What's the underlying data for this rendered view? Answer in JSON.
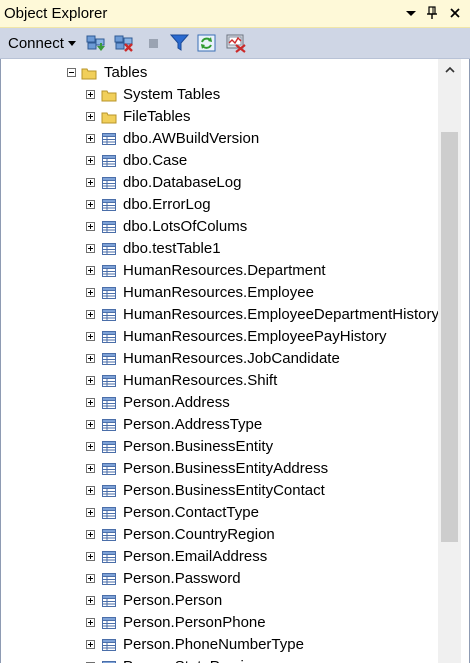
{
  "window": {
    "title": "Object Explorer",
    "controls": [
      "dropdown-icon",
      "pin-icon",
      "close-icon"
    ]
  },
  "toolbar": {
    "connect_label": "Connect",
    "buttons": [
      "connect-object-explorer-icon",
      "disconnect-icon",
      "stop-icon",
      "filter-icon",
      "refresh-icon",
      "activity-monitor-icon"
    ]
  },
  "tree": {
    "root": {
      "label": "Tables",
      "expanded": true
    },
    "children": [
      {
        "label": "System Tables",
        "type": "folder"
      },
      {
        "label": "FileTables",
        "type": "folder"
      },
      {
        "label": "dbo.AWBuildVersion",
        "type": "table"
      },
      {
        "label": "dbo.Case",
        "type": "table"
      },
      {
        "label": "dbo.DatabaseLog",
        "type": "table"
      },
      {
        "label": "dbo.ErrorLog",
        "type": "table"
      },
      {
        "label": "dbo.LotsOfColums",
        "type": "table"
      },
      {
        "label": "dbo.testTable1",
        "type": "table"
      },
      {
        "label": "HumanResources.Department",
        "type": "table"
      },
      {
        "label": "HumanResources.Employee",
        "type": "table"
      },
      {
        "label": "HumanResources.EmployeeDepartmentHistory",
        "type": "table"
      },
      {
        "label": "HumanResources.EmployeePayHistory",
        "type": "table"
      },
      {
        "label": "HumanResources.JobCandidate",
        "type": "table"
      },
      {
        "label": "HumanResources.Shift",
        "type": "table"
      },
      {
        "label": "Person.Address",
        "type": "table"
      },
      {
        "label": "Person.AddressType",
        "type": "table"
      },
      {
        "label": "Person.BusinessEntity",
        "type": "table"
      },
      {
        "label": "Person.BusinessEntityAddress",
        "type": "table"
      },
      {
        "label": "Person.BusinessEntityContact",
        "type": "table"
      },
      {
        "label": "Person.ContactType",
        "type": "table"
      },
      {
        "label": "Person.CountryRegion",
        "type": "table"
      },
      {
        "label": "Person.EmailAddress",
        "type": "table"
      },
      {
        "label": "Person.Password",
        "type": "table"
      },
      {
        "label": "Person.Person",
        "type": "table"
      },
      {
        "label": "Person.PersonPhone",
        "type": "table"
      },
      {
        "label": "Person.PhoneNumberType",
        "type": "table"
      },
      {
        "label": "Person.StateProvince",
        "type": "table"
      }
    ]
  },
  "colors": {
    "title_bg": "#fef9d8",
    "toolbar_bg": "#cfd6e5",
    "folder": "#e8c44a",
    "table_icon": "#4a6ea9"
  }
}
